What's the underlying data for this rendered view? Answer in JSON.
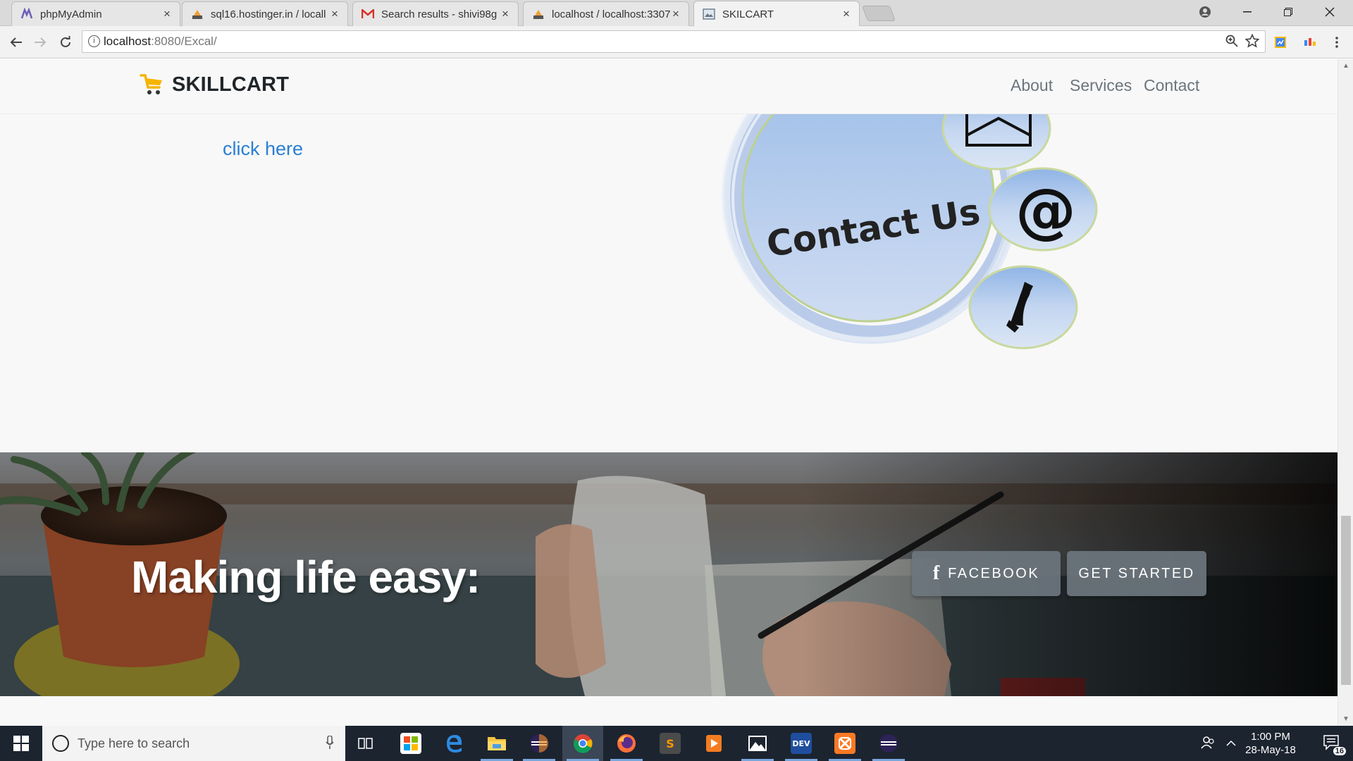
{
  "browser": {
    "tabs": [
      {
        "title": "phpMyAdmin",
        "icon": "phpmyadmin-icon",
        "active": false
      },
      {
        "title": "sql16.hostinger.in / locall",
        "icon": "pma-icon",
        "active": false
      },
      {
        "title": "Search results - shivi98g",
        "icon": "gmail-icon",
        "active": false
      },
      {
        "title": "localhost / localhost:3307",
        "icon": "pma-icon",
        "active": false
      },
      {
        "title": "SKILCART",
        "icon": "page-icon",
        "active": true
      }
    ],
    "address": {
      "host": "localhost",
      "path": ":8080/Excal/"
    }
  },
  "site": {
    "brand": "SKILLCART",
    "nav": [
      {
        "label": "About"
      },
      {
        "label": "Services"
      },
      {
        "label": "Contact"
      }
    ],
    "link_text": "click here",
    "illustration": {
      "heading": "Contact Us",
      "at_symbol": "@"
    },
    "cta": {
      "title": "Making life easy:",
      "facebook_icon_glyph": "f",
      "facebook_label": "FACEBOOK",
      "started_label": "GET STARTED"
    }
  },
  "taskbar": {
    "search_placeholder": "Type here to search",
    "time": "1:00 PM",
    "date": "28-May-18",
    "notification_count": "16",
    "apps": [
      {
        "name": "task-view-icon"
      },
      {
        "name": "store-icon"
      },
      {
        "name": "edge-icon"
      },
      {
        "name": "file-explorer-icon"
      },
      {
        "name": "eclipse-icon"
      },
      {
        "name": "chrome-icon"
      },
      {
        "name": "firefox-icon"
      },
      {
        "name": "sublime-icon"
      },
      {
        "name": "media-player-icon"
      },
      {
        "name": "photos-icon"
      },
      {
        "name": "devc-icon",
        "label": "DEV"
      },
      {
        "name": "xampp-icon"
      },
      {
        "name": "eclipse-icon-2"
      }
    ]
  },
  "colors": {
    "nav_text": "#6c757d",
    "link": "#2a7fd4",
    "button_bg": "#6c757d",
    "taskbar": "#1c2430"
  }
}
